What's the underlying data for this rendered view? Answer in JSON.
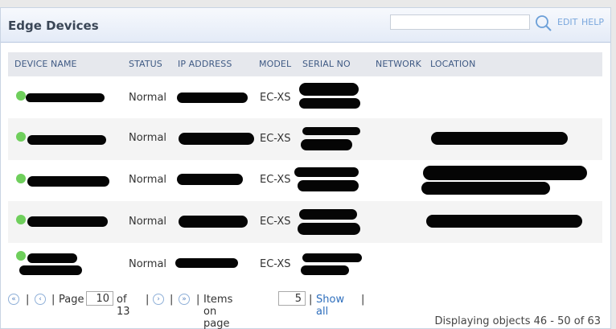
{
  "header": {
    "title": "Edge Devices",
    "search_value": "",
    "edit_label": "EDIT",
    "help_label": "HELP"
  },
  "table": {
    "columns": [
      "DEVICE NAME",
      "STATUS",
      "IP ADDRESS",
      "MODEL",
      "SERIAL NO",
      "NETWORK",
      "LOCATION"
    ],
    "rows": [
      {
        "status": "Normal",
        "model": "EC-XS",
        "status_color": "#6fcf5c"
      },
      {
        "status": "Normal",
        "model": "EC-XS",
        "status_color": "#6fcf5c"
      },
      {
        "status": "Normal",
        "model": "EC-XS",
        "status_color": "#6fcf5c"
      },
      {
        "status": "Normal",
        "model": "EC-XS",
        "status_color": "#6fcf5c"
      },
      {
        "status": "Normal",
        "model": "EC-XS",
        "status_color": "#6fcf5c"
      }
    ]
  },
  "pager": {
    "sep": "|",
    "page_label": "Page",
    "page_value": "10",
    "of_label": "of 13",
    "items_label": "Items on page",
    "items_value": "5",
    "show_all": "Show all",
    "first_icon": "«",
    "prev_icon": "‹",
    "next_icon": "›",
    "last_icon": "»"
  },
  "footer": {
    "displaying": "Displaying objects 46 - 50 of 63"
  },
  "colors": {
    "accent": "#2f6fbd",
    "status_ok": "#6fcf5c"
  }
}
